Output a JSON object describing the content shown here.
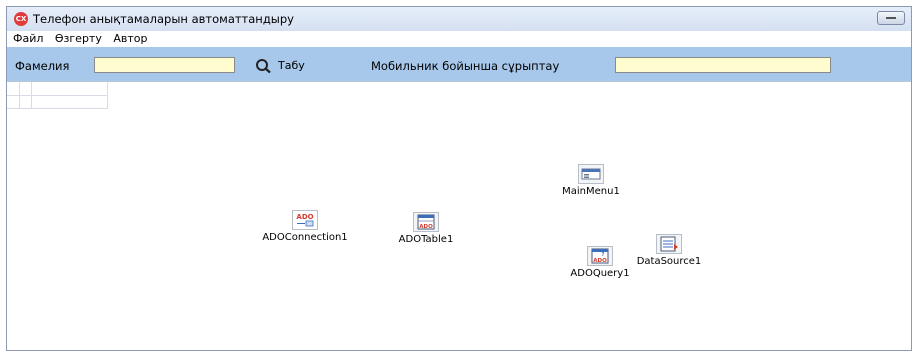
{
  "window": {
    "title": "Телефон анықтамаларын автоматтандыру",
    "app_icon_text": "CX",
    "accent_color": "#a7c8ea"
  },
  "menu": {
    "items": [
      "Файл",
      "Өзгерту",
      "Автор"
    ]
  },
  "toolbar": {
    "surname_label": "Фамелия",
    "surname_value": "",
    "search_button_label": "Табу",
    "search_icon": "magnifier-icon",
    "sort_label": "Мобильник бойынша сұрыптау",
    "sort_value": ""
  },
  "components": [
    {
      "id": "mainmenu",
      "label": "MainMenu1",
      "icon": "main-menu-icon"
    },
    {
      "id": "adoconnection",
      "label": "ADOConnection1",
      "icon": "ado-connection-icon",
      "icon_text": "ADO"
    },
    {
      "id": "adotable",
      "label": "ADOTable1",
      "icon": "ado-table-icon",
      "icon_text": "ADO"
    },
    {
      "id": "adoquery",
      "label": "ADOQuery1",
      "icon": "ado-query-icon",
      "icon_text": "ADO"
    },
    {
      "id": "datasource",
      "label": "DataSource1",
      "icon": "data-source-icon"
    }
  ]
}
